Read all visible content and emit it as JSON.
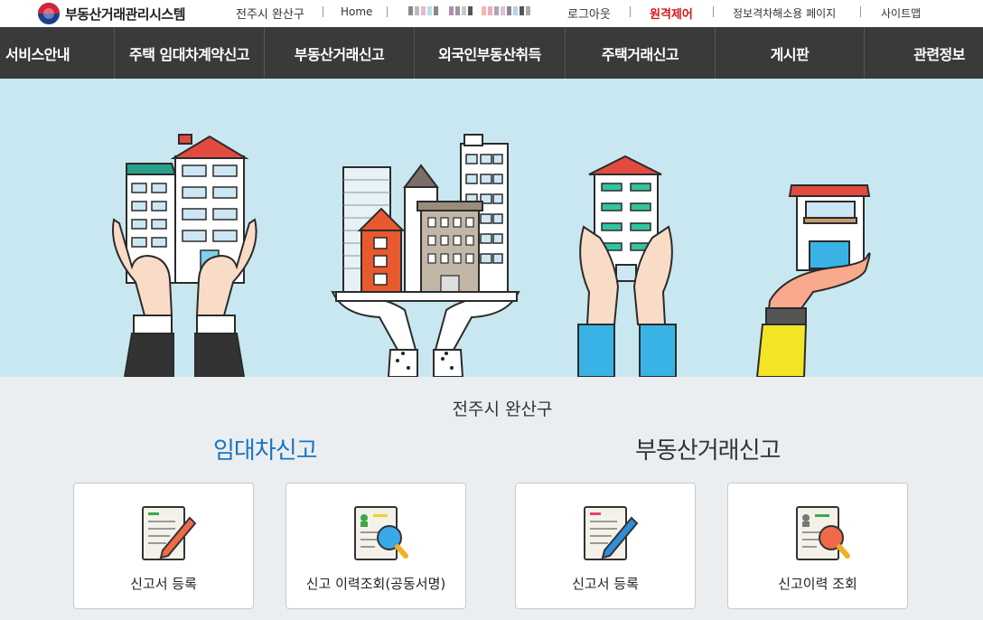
{
  "header": {
    "logo_text": "부동산거래관리시스템",
    "util_links": [
      "전주시 완산구",
      "Home",
      "로그아웃",
      "원격제어",
      "정보격차해소용 페이지",
      "사이트맵"
    ]
  },
  "nav": {
    "items": [
      "서비스안내",
      "주택 임대차계약신고",
      "부동산거래신고",
      "외국인부동산취득",
      "주택거래신고",
      "게시판",
      "관련정보"
    ]
  },
  "main": {
    "region": "전주시 완산구",
    "lease": {
      "title": "임대차신고",
      "cards": [
        "신고서 등록",
        "신고 이력조회(공동서명)"
      ]
    },
    "trade": {
      "title": "부동산거래신고",
      "cards": [
        "신고서 등록",
        "신고이력 조회"
      ]
    }
  },
  "colors": {
    "nav_bg": "#3a3a3a",
    "hero_bg": "#c8e7f1",
    "accent_blue": "#1a75c2",
    "alert_red": "#d01818"
  },
  "icons": [
    "document-edit-icon",
    "document-search-icon",
    "document-edit-icon",
    "document-search-icon"
  ]
}
